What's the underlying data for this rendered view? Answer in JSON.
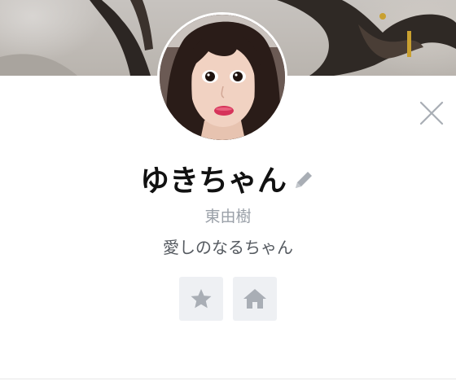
{
  "profile": {
    "display_name": "ゆきちゃん",
    "line_id": "東由樹",
    "status_message": "愛しのなるちゃん"
  },
  "icons": {
    "close": "close-icon",
    "edit": "pencil-icon",
    "favorite": "star-icon",
    "home": "home-icon"
  },
  "colors": {
    "icon_gray": "#a9aeb5",
    "button_bg": "#eef0f3",
    "name_text": "#111111",
    "id_text": "#9aa0a8",
    "status_text": "#555a60"
  }
}
